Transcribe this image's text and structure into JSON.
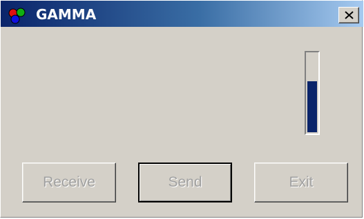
{
  "window": {
    "title": "GAMMA"
  },
  "icons": {
    "app": "rgb-circles-icon",
    "close": "close-x-icon"
  },
  "progress": {
    "value_fraction": 0.65,
    "fill_color": "#0a246a"
  },
  "buttons": {
    "receive_label": "Receive",
    "send_label": "Send",
    "exit_label": "Exit"
  },
  "colors": {
    "titlebar_start": "#0a246a",
    "titlebar_end": "#a6caf0",
    "window_bg": "#d4d0c8",
    "disabled_text": "#a0a0a0"
  }
}
